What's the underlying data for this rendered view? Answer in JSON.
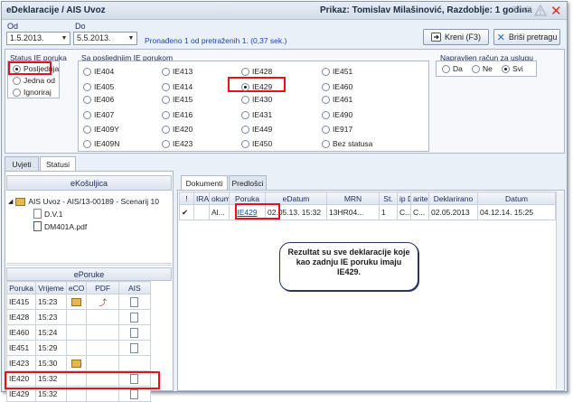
{
  "window": {
    "title": "eDeklaracije / AIS Uvoz",
    "prikaz": "Prikaz: Tomislav Milašinović, Razdoblje: 1 godina",
    "search_label": "Traži"
  },
  "filters": {
    "od_label": "Od",
    "do_label": "Do",
    "od_value": "1.5.2013.",
    "do_value": "5.5.2013.",
    "result_info": "Pronađeno 1 od pretraženih 1. (0,37 sek.)",
    "create_button": "Kreni (F3)",
    "clear_button": "Briši pretragu"
  },
  "status_group": {
    "title": "Status IE poruka",
    "options": [
      "Posljednja",
      "Jedna od",
      "Ignoriraj"
    ],
    "selected": "Posljednja"
  },
  "ie_group": {
    "title": "Sa posljednjim IE porukom",
    "columns": [
      [
        "IE404",
        "IE405",
        "IE406",
        "IE407",
        "IE409Y",
        "IE409N"
      ],
      [
        "IE413",
        "IE414",
        "IE415",
        "IE416",
        "IE420",
        "IE423"
      ],
      [
        "IE428",
        "IE429",
        "IE430",
        "IE431",
        "IE449",
        "IE450"
      ],
      [
        "IE451",
        "IE460",
        "IE461",
        "IE490",
        "IE917",
        "Bez statusa"
      ]
    ],
    "selected": "IE429"
  },
  "usluga_group": {
    "title": "Napravljen račun za uslugu",
    "options": [
      "Da",
      "Ne",
      "Svi"
    ],
    "selected": "Svi"
  },
  "main_tabs": [
    "Uvjeti",
    "Statusi"
  ],
  "kosuljica": {
    "title": "eKošuljica",
    "tree": {
      "root": "AIS Uvoz - AIS/13-00189 - Scenarij 10",
      "children": [
        "D.V.1",
        "DM401A.pdf"
      ]
    }
  },
  "eporuke": {
    "title": "ePoruke",
    "headers": [
      "Poruka",
      "Vrijeme",
      "eCO",
      "PDF",
      "AIS"
    ],
    "rows": [
      {
        "poruka": "IE415",
        "vrijeme": "15:23",
        "eco": true,
        "pdf": true,
        "ais": true
      },
      {
        "poruka": "IE428",
        "vrijeme": "15:23",
        "eco": false,
        "pdf": false,
        "ais": true
      },
      {
        "poruka": "IE460",
        "vrijeme": "15:24",
        "eco": false,
        "pdf": false,
        "ais": true
      },
      {
        "poruka": "IE451",
        "vrijeme": "15:29",
        "eco": false,
        "pdf": false,
        "ais": true
      },
      {
        "poruka": "IE423",
        "vrijeme": "15:30",
        "eco": true,
        "pdf": false,
        "ais": false
      },
      {
        "poruka": "IE420",
        "vrijeme": "15:32",
        "eco": false,
        "pdf": false,
        "ais": true
      },
      {
        "poruka": "IE429",
        "vrijeme": "15:32",
        "eco": false,
        "pdf": false,
        "ais": true
      }
    ]
  },
  "doc_tabs": [
    "Dokumenti",
    "Predlošci"
  ],
  "doc_table": {
    "headers": [
      "!",
      "IRA",
      "okumen",
      "Poruka",
      "eDatum",
      "MRN",
      "St.",
      "ip D",
      "arite",
      "Deklarirano",
      "Datum"
    ],
    "row": {
      "check": "✔",
      "ira": "",
      "dokument": "Al...",
      "poruka": "IE429",
      "edatum": "02.05.13. 15:32",
      "mrn": "13HR04...",
      "st": "1",
      "tip": "C...",
      "carite": "C...",
      "deklarirano": "02.05.2013",
      "datum": "04.12.14. 15:25"
    }
  },
  "callout": "Rezultat su sve deklaracije koje kao zadnju IE poruku imaju IE429."
}
